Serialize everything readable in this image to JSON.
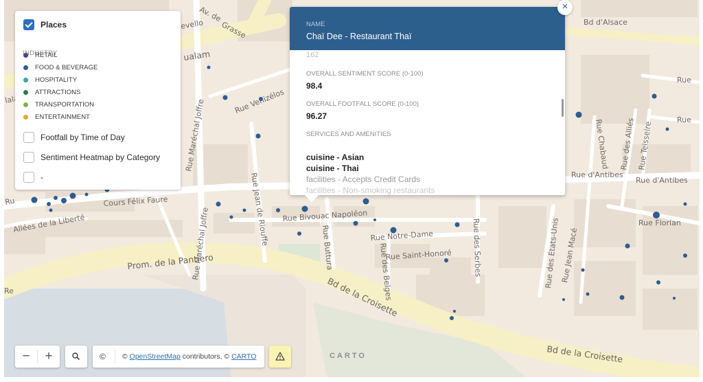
{
  "map": {
    "streets": {
      "avenue_de_grasse": "Av. de Grasse",
      "avenue_de_grasse_a": "Av. de",
      "avenue_de_grasse_b": "Grasse",
      "rue_felix_faure_frag": "rue",
      "bd_alsace": "Bd d'Alsace",
      "rue_top_right": "Rue",
      "rue_top_right2": "Rue",
      "rue_venizelos": "Rue Venizélos",
      "rue_marechal_joffre": "Rue Maréchal Joffre",
      "rue_marechal_joffre_2": "Rue Maréchal Joffre",
      "rue_chabaud": "Rue Chabaud",
      "rue_des_allies": "Rue des Alliés",
      "rue_teisseire": "Rue Teisseire",
      "rue_dantibes_1": "Rue d'Antibes",
      "rue_dantibes_2": "Rue d'Antibes",
      "rue_jean_de_riouffe": "Rue Jean de Riouffe",
      "cours_felix_faure": "Cours Félix Faure",
      "allees_liberte": "Allées de la Liberté",
      "rue_bivouac": "Rue Bivouac Napoléon",
      "rue_buttura": "Rue Buttura",
      "rue_notre_dame": "Rue Notre-Dame",
      "rue_saint_honore": "Rue Saint-Honoré",
      "rue_des_belges": "Rue des Belges",
      "rue_des_serbes": "Rue des Serbes",
      "rue_etats_unis": "Rue des États-Unis",
      "rue_jean_mace": "Rue Jean Macé",
      "rue_florian": "Rue Florian",
      "prom_pantiero": "Prom. de la Pantiero",
      "bd_croisette_1": "Bd de la Croisette",
      "bd_croisette_2": "Bd de la Croisette",
      "frag_ualam": "ualam",
      "frag_lala": "lala",
      "frag_ru": "Ru",
      "frag_re": "Re",
      "frag_vello": "evello",
      "frag_ma": "ma",
      "frag_ue": "ue"
    }
  },
  "legend": {
    "places_label": "Places",
    "places_checked": true,
    "industry_title": "INDUSTRY",
    "industries": [
      {
        "label": "RETAIL",
        "color": "#5b3f8c"
      },
      {
        "label": "FOOD & BEVERAGE",
        "color": "#2e5d8f"
      },
      {
        "label": "HOSPITALITY",
        "color": "#3aa5a0"
      },
      {
        "label": "ATTRACTIONS",
        "color": "#2f7a4d"
      },
      {
        "label": "TRANSPORTATION",
        "color": "#7fb34a"
      },
      {
        "label": "ENTERTAINMENT",
        "color": "#e0a83a"
      }
    ],
    "layers": [
      {
        "label": "Footfall by Time of Day",
        "checked": false
      },
      {
        "label": "Sentiment Heatmap by Category",
        "checked": false
      },
      {
        "label": "-",
        "checked": false
      }
    ]
  },
  "popup": {
    "name_label": "NAME",
    "name_value": "Chaï Dee - Restaurant Thaï",
    "partial_value": "162",
    "sentiment_label": "OVERALL SENTIMENT SCORE (0-100)",
    "sentiment_value": "98.4",
    "footfall_label": "OVERALL FOOTFALL SCORE (0-100)",
    "footfall_value": "96.27",
    "services_label": "SERVICES AND AMENITIES",
    "amenities": [
      "cuisine - Asian",
      "cuisine - Thai",
      "facilities - Accepts Credit Cards",
      "facilities - Non-smoking restaurants"
    ],
    "close_icon": "close-icon"
  },
  "controls": {
    "zoom_out": "−",
    "zoom_in": "+",
    "search_icon": "search-icon",
    "copyright_symbol": "©",
    "attribution_prefix": "©",
    "osm_link": "OpenStreetMap",
    "attribution_middle": "contributors, ©",
    "carto_link": "CARTO",
    "warning_icon": "warning-icon",
    "carto_logo": "CARTO"
  },
  "colors": {
    "map_bg": "#f2e9df",
    "major_road": "#f8f0c4",
    "block": "#e7dcd0",
    "water": "#d5dce2",
    "park": "#dfe6d6",
    "dot": "#2e5d8f",
    "popup_header": "#2d5f8d"
  }
}
